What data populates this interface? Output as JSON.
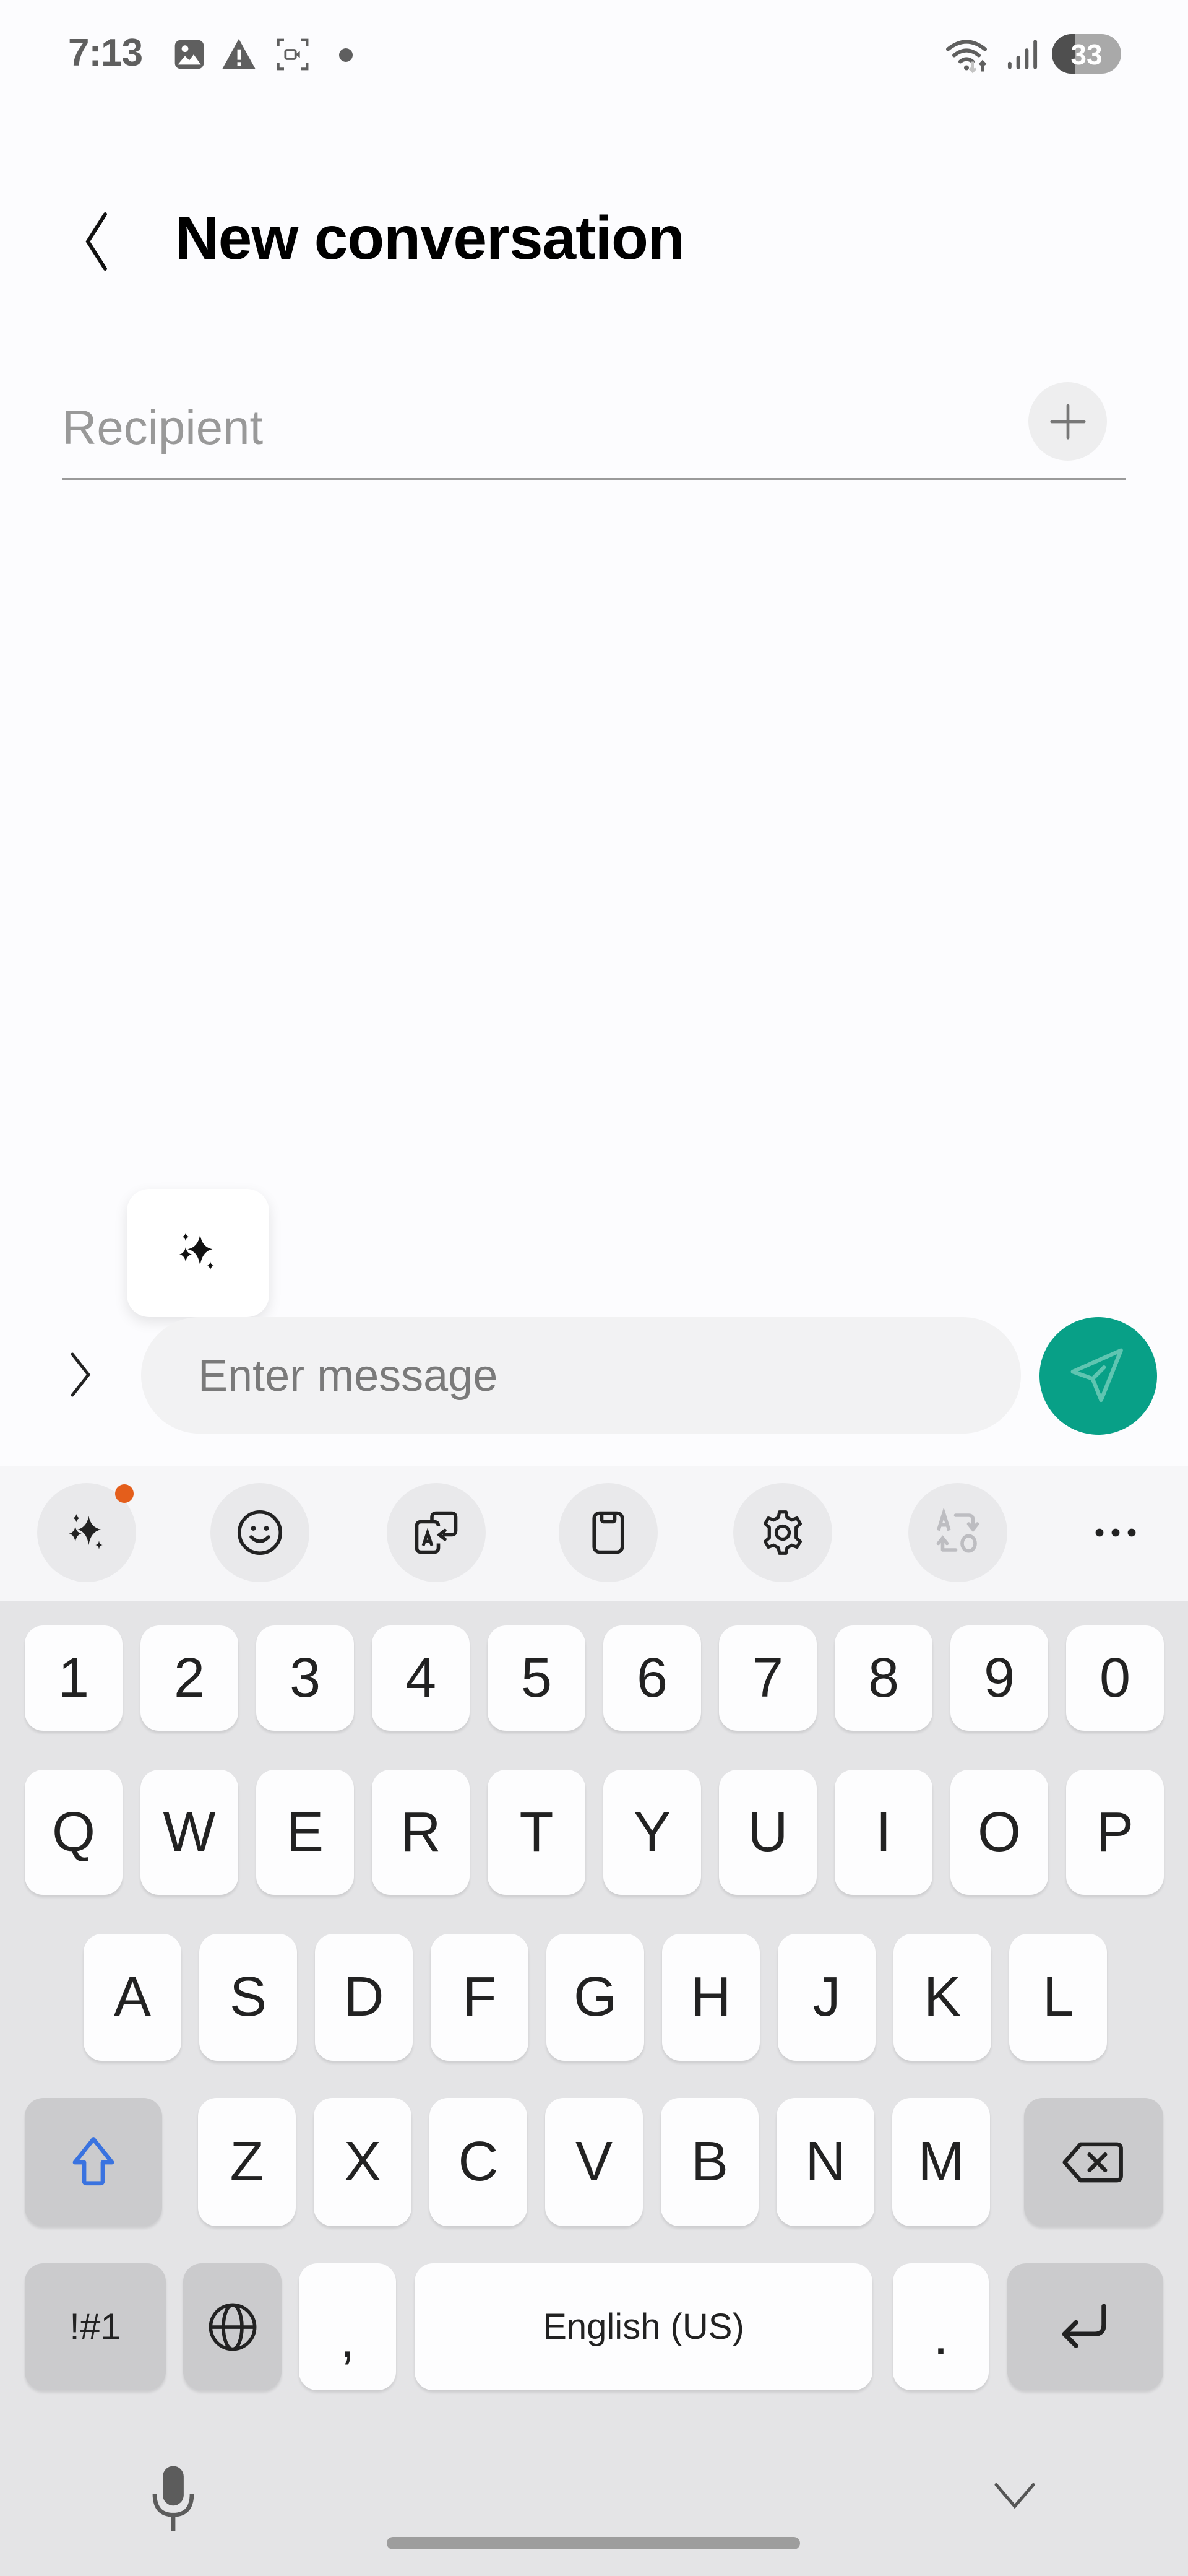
{
  "status_bar": {
    "time": "7:13",
    "left_icons": [
      "gallery-icon",
      "warning-icon",
      "screen-recorder-icon",
      "notification-dot-icon"
    ],
    "right_icons": [
      "wifi-icon",
      "signal-icon"
    ],
    "battery_level": "33",
    "battery_percent": 33
  },
  "header": {
    "back_icon": "chevron-left-icon",
    "title": "New conversation"
  },
  "recipient": {
    "placeholder": "Recipient",
    "value": "",
    "add_icon": "plus-icon"
  },
  "compose": {
    "ai_button_icon": "sparkles-icon",
    "expand_icon": "chevron-right-icon",
    "message_placeholder": "Enter message",
    "message_value": "",
    "send_icon": "send-icon",
    "send_color": "#08a087"
  },
  "keyboard_toolbar": {
    "items": [
      {
        "name": "galaxy-ai",
        "icon": "sparkles-icon",
        "badge": true
      },
      {
        "name": "emoji",
        "icon": "smiley-icon"
      },
      {
        "name": "translate",
        "icon": "translate-icon"
      },
      {
        "name": "clipboard",
        "icon": "clipboard-icon"
      },
      {
        "name": "settings",
        "icon": "gear-icon"
      },
      {
        "name": "text-convert",
        "icon": "text-convert-icon",
        "disabled": true
      },
      {
        "name": "more",
        "icon": "more-horizontal-icon"
      }
    ],
    "badge_color": "#e45e1b"
  },
  "keyboard": {
    "row_numbers": [
      "1",
      "2",
      "3",
      "4",
      "5",
      "6",
      "7",
      "8",
      "9",
      "0"
    ],
    "row_1": [
      "Q",
      "W",
      "E",
      "R",
      "T",
      "Y",
      "U",
      "I",
      "O",
      "P"
    ],
    "row_2": [
      "A",
      "S",
      "D",
      "F",
      "G",
      "H",
      "J",
      "K",
      "L"
    ],
    "row_3": [
      "Z",
      "X",
      "C",
      "V",
      "B",
      "N",
      "M"
    ],
    "shift_icon": "shift-icon",
    "shift_color": "#3a73e0",
    "backspace_icon": "backspace-icon",
    "symbols_label": "!#1",
    "language_icon": "globe-icon",
    "comma_label": ",",
    "space_label": "English (US)",
    "period_label": ".",
    "enter_icon": "enter-icon"
  },
  "nav": {
    "mic_icon": "microphone-icon",
    "hide_keyboard_icon": "chevron-down-icon"
  }
}
